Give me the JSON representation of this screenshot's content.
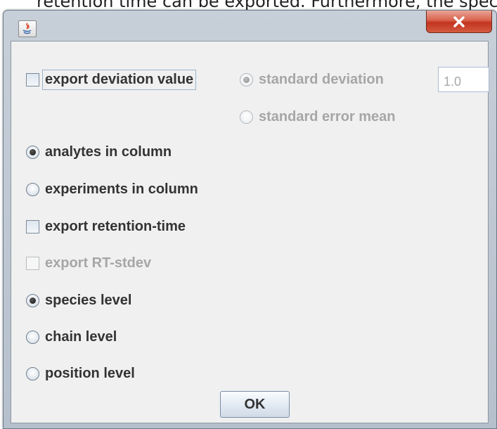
{
  "background": {
    "partial_text": "retention time can be exported. Furthermore, the spec"
  },
  "window": {
    "app_icon": "java-icon",
    "close_icon": "close-icon"
  },
  "options": {
    "export_deviation": {
      "label": "export deviation value",
      "checked": false
    },
    "standard_deviation": {
      "label": "standard deviation",
      "checked": true,
      "enabled": false
    },
    "deviation_value": {
      "value": "1.0"
    },
    "standard_error_mean": {
      "label": "standard error mean",
      "checked": false,
      "enabled": false
    },
    "analytes_in_column": {
      "label": "analytes in column",
      "checked": true
    },
    "experiments_in_column": {
      "label": "experiments in column",
      "checked": false
    },
    "export_retention_time": {
      "label": "export retention-time",
      "checked": false
    },
    "export_rt_stdev": {
      "label": "export RT-stdev",
      "checked": false,
      "enabled": false
    },
    "species_level": {
      "label": "species level",
      "checked": true
    },
    "chain_level": {
      "label": "chain level",
      "checked": false
    },
    "position_level": {
      "label": "position level",
      "checked": false
    }
  },
  "buttons": {
    "ok": "OK"
  }
}
